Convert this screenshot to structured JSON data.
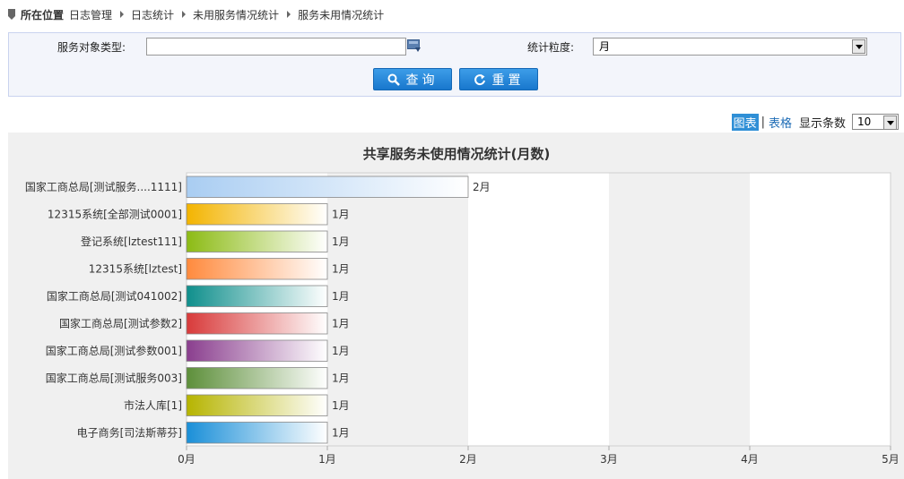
{
  "breadcrumb": {
    "label": "所在位置",
    "items": [
      "日志管理",
      "日志统计",
      "未用服务情况统计",
      "服务未用情况统计"
    ]
  },
  "filter": {
    "type_label": "服务对象类型:",
    "type_value": "",
    "granularity_label": "统计粒度:",
    "granularity_value": "月",
    "query_label": "查询",
    "reset_label": "重置"
  },
  "toolbar": {
    "chart_label": "图表",
    "table_label": "表格",
    "count_label": "显示条数",
    "count_value": "10"
  },
  "chart_data": {
    "type": "bar",
    "orientation": "horizontal",
    "title": "共享服务未使用情况统计(月数)",
    "unit": "月",
    "categories": [
      "国家工商总局[测试服务....1111]",
      "12315系统[全部测试0001]",
      "登记系统[lztest111]",
      "12315系统[lztest]",
      "国家工商总局[测试041002]",
      "国家工商总局[测试参数2]",
      "国家工商总局[测试参数001]",
      "国家工商总局[测试服务003]",
      "市法人库[1]",
      "电子商务[司法斯蒂芬]"
    ],
    "values": [
      2,
      1,
      1,
      1,
      1,
      1,
      1,
      1,
      1,
      1
    ],
    "value_labels": [
      "2月",
      "1月",
      "1月",
      "1月",
      "1月",
      "1月",
      "1月",
      "1月",
      "1月",
      "1月"
    ],
    "xlim": [
      0,
      5
    ],
    "x_ticks": [
      "0月",
      "1月",
      "2月",
      "3月",
      "4月",
      "5月"
    ],
    "bar_colors": [
      "#a9cdf2",
      "#f3b400",
      "#8cbb14",
      "#ff8a3d",
      "#0f8f8c",
      "#d83a3a",
      "#8a3e8e",
      "#5d8f3a",
      "#b6b400",
      "#1a8fd8"
    ],
    "band_shading": "alternating"
  }
}
